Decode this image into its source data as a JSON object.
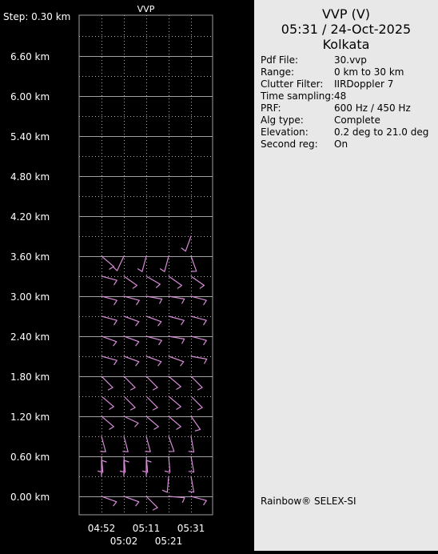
{
  "chart_data": {
    "type": "wind-profile (VVP barbs)",
    "title": "VVP",
    "step_label": "Step: 0.30 km",
    "y_tick_labels": [
      "0.00 km",
      "0.60 km",
      "1.20 km",
      "1.80 km",
      "2.40 km",
      "3.00 km",
      "3.60 km",
      "4.20 km",
      "4.80 km",
      "5.40 km",
      "6.00 km",
      "6.60 km"
    ],
    "y_ticks_km": [
      0.0,
      0.6,
      1.2,
      1.8,
      2.4,
      3.0,
      3.6,
      4.2,
      4.8,
      5.4,
      6.0,
      6.6
    ],
    "ylim_km": [
      0.0,
      7.2
    ],
    "x_tick_labels_top": [
      "04:52",
      "05:11",
      "05:31"
    ],
    "x_tick_labels_bottom": [
      "05:02",
      "05:21"
    ],
    "times": [
      "04:52",
      "05:02",
      "05:11",
      "05:21",
      "05:31"
    ],
    "levels_km": [
      0.0,
      0.3,
      0.6,
      0.9,
      1.2,
      1.5,
      1.8,
      2.1,
      2.4,
      2.7,
      3.0,
      3.3,
      3.6,
      3.9
    ],
    "series": [
      {
        "time": "04:52",
        "directions_deg": [
          110,
          0,
          175,
          165,
          130,
          130,
          135,
          105,
          110,
          105,
          105,
          105,
          130,
          null
        ]
      },
      {
        "time": "05:02",
        "directions_deg": [
          110,
          0,
          175,
          165,
          115,
          135,
          135,
          110,
          110,
          110,
          105,
          125,
          205,
          null
        ]
      },
      {
        "time": "05:11",
        "directions_deg": [
          135,
          0,
          175,
          165,
          130,
          135,
          135,
          110,
          105,
          110,
          100,
          120,
          195,
          null
        ]
      },
      {
        "time": "05:21",
        "directions_deg": [
          95,
          185,
          175,
          160,
          130,
          130,
          130,
          110,
          100,
          105,
          100,
          125,
          195,
          null
        ]
      },
      {
        "time": "05:31",
        "directions_deg": [
          105,
          170,
          170,
          170,
          145,
          135,
          135,
          100,
          105,
          105,
          105,
          125,
          160,
          200
        ]
      }
    ],
    "grid": true
  },
  "info": {
    "title": "VVP (V)",
    "datetime": "05:31 / 24-Oct-2025",
    "location": "Kolkata",
    "rows": [
      {
        "k": "Pdf File:",
        "v": "30.vvp"
      },
      {
        "k": "Range:",
        "v": "0 km to 30 km"
      },
      {
        "k": "Clutter Filter:",
        "v": "IIRDoppler 7"
      },
      {
        "k": "Time sampling:",
        "v": "48"
      },
      {
        "k": "PRF:",
        "v": "600 Hz / 450 Hz"
      },
      {
        "k": "Alg type:",
        "v": "Complete"
      },
      {
        "k": "Elevation:",
        "v": "0.2 deg to 21.0 deg"
      },
      {
        "k": "Second reg:",
        "v": "On"
      }
    ],
    "footer": "Rainbow® SELEX-SI"
  },
  "colors": {
    "barb": "#d88cd8",
    "grid_solid": "#a0a0a0",
    "grid_dotted": "#b0b0b0",
    "text": "#ffffff"
  }
}
